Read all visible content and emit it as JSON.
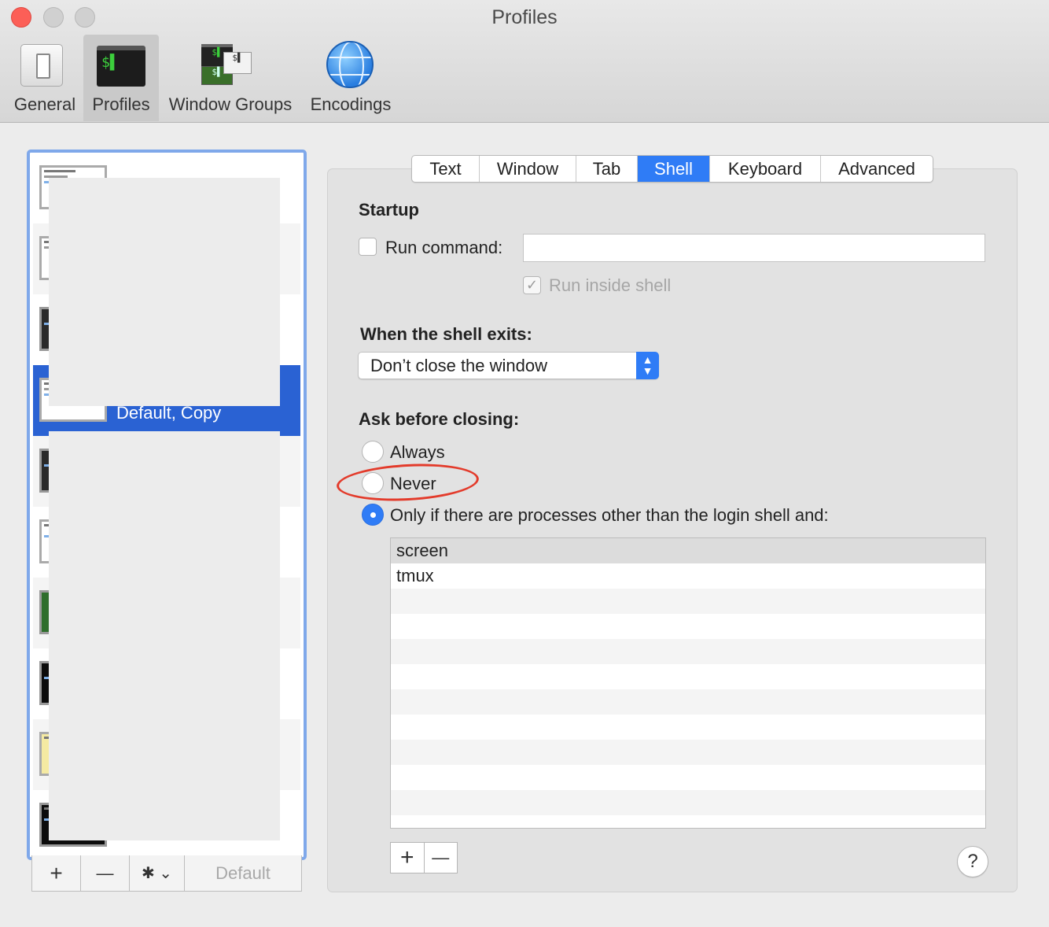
{
  "window": {
    "title": "Profiles"
  },
  "toolbar": {
    "items": [
      {
        "label": "General",
        "icon": "general-switch-icon"
      },
      {
        "label": "Profiles",
        "icon": "terminal-icon",
        "selected": true
      },
      {
        "label": "Window Groups",
        "icon": "window-groups-icon"
      },
      {
        "label": "Encodings",
        "icon": "globe-icon"
      }
    ],
    "profiles_icon_text": "$▌",
    "wg_icon_text": [
      "$▌",
      "$▌",
      "$▌"
    ]
  },
  "profile_list": {
    "selected_name": "Default, Copy",
    "footer": {
      "add": "+",
      "remove": "—",
      "gear": "✱ ⌄",
      "default_label": "Default"
    }
  },
  "tabs": [
    "Text",
    "Window",
    "Tab",
    "Shell",
    "Keyboard",
    "Advanced"
  ],
  "selected_tab": "Shell",
  "shell": {
    "startup_heading": "Startup",
    "run_command_label": "Run command:",
    "run_command_value": "",
    "run_inside_shell_label": "Run inside shell",
    "run_inside_shell_checked": true,
    "exits_heading": "When the shell exits:",
    "exits_value": "Don’t close the window",
    "ask_heading": "Ask before closing:",
    "radio_always": "Always",
    "radio_never": "Never",
    "radio_only_if": "Only if there are processes other than the login shell and:",
    "selected_radio": "only_if",
    "processes": [
      "screen",
      "tmux"
    ],
    "table_add": "+",
    "table_remove": "—",
    "help": "?"
  },
  "colors": {
    "accent": "#2f7cf6",
    "selected_row": "#2a62d3",
    "annotation": "#e33b2b"
  }
}
